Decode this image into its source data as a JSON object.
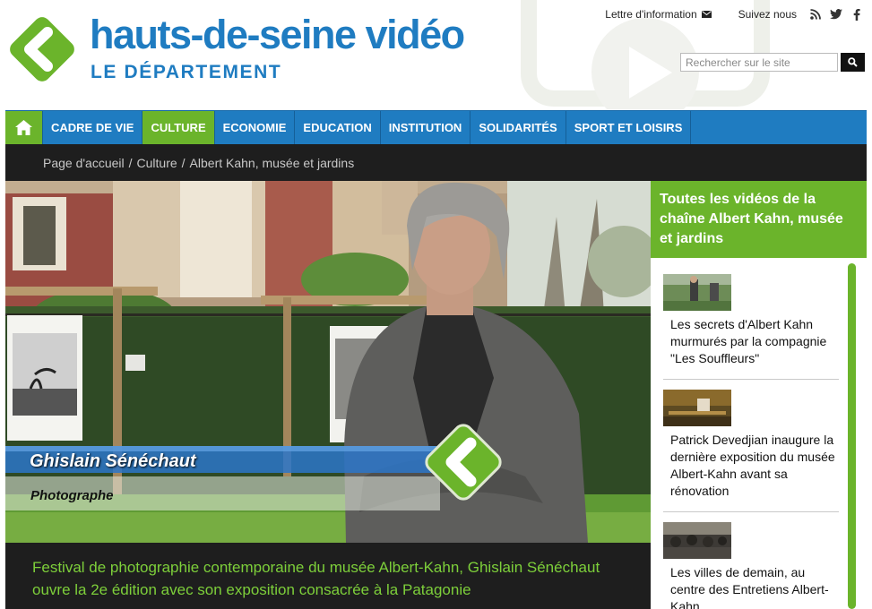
{
  "brand": {
    "title": "hauts-de-seine vidéo",
    "subtitle": "LE DÉPARTEMENT",
    "green": "#6bb42b",
    "blue": "#1f7cc1"
  },
  "top_links": {
    "newsletter": "Lettre d'information",
    "follow": "Suivez nous",
    "social_icons": [
      "rss-icon",
      "twitter-icon",
      "facebook-icon"
    ]
  },
  "search": {
    "placeholder": "Rechercher sur le site",
    "value": ""
  },
  "nav": {
    "items": [
      {
        "label": "CADRE DE VIE",
        "active": false
      },
      {
        "label": "CULTURE",
        "active": true
      },
      {
        "label": "ECONOMIE",
        "active": false
      },
      {
        "label": "EDUCATION",
        "active": false
      },
      {
        "label": "INSTITUTION",
        "active": false
      },
      {
        "label": "SOLIDARITÉS",
        "active": false
      },
      {
        "label": "SPORT ET LOISIRS",
        "active": false
      }
    ]
  },
  "breadcrumb": [
    "Page d'accueil",
    "Culture",
    "Albert Kahn, musée et jardins"
  ],
  "video": {
    "name": "Ghislain Sénéchaut",
    "role": "Photographe",
    "caption": "Festival de photographie contemporaine du musée Albert-Kahn, Ghislain Sénéchaut ouvre la 2e édition avec son exposition consacrée à la Patagonie"
  },
  "sidebar": {
    "heading": "Toutes les vidéos de la chaîne Albert Kahn, musée et jardins",
    "items": [
      {
        "title": "Les secrets d'Albert Kahn murmurés par la compagnie \"Les Souffleurs\""
      },
      {
        "title": "Patrick Devedjian inaugure la dernière exposition du musée Albert-Kahn avant sa rénovation"
      },
      {
        "title": "Les villes de demain, au centre des Entretiens Albert-Kahn"
      }
    ]
  }
}
